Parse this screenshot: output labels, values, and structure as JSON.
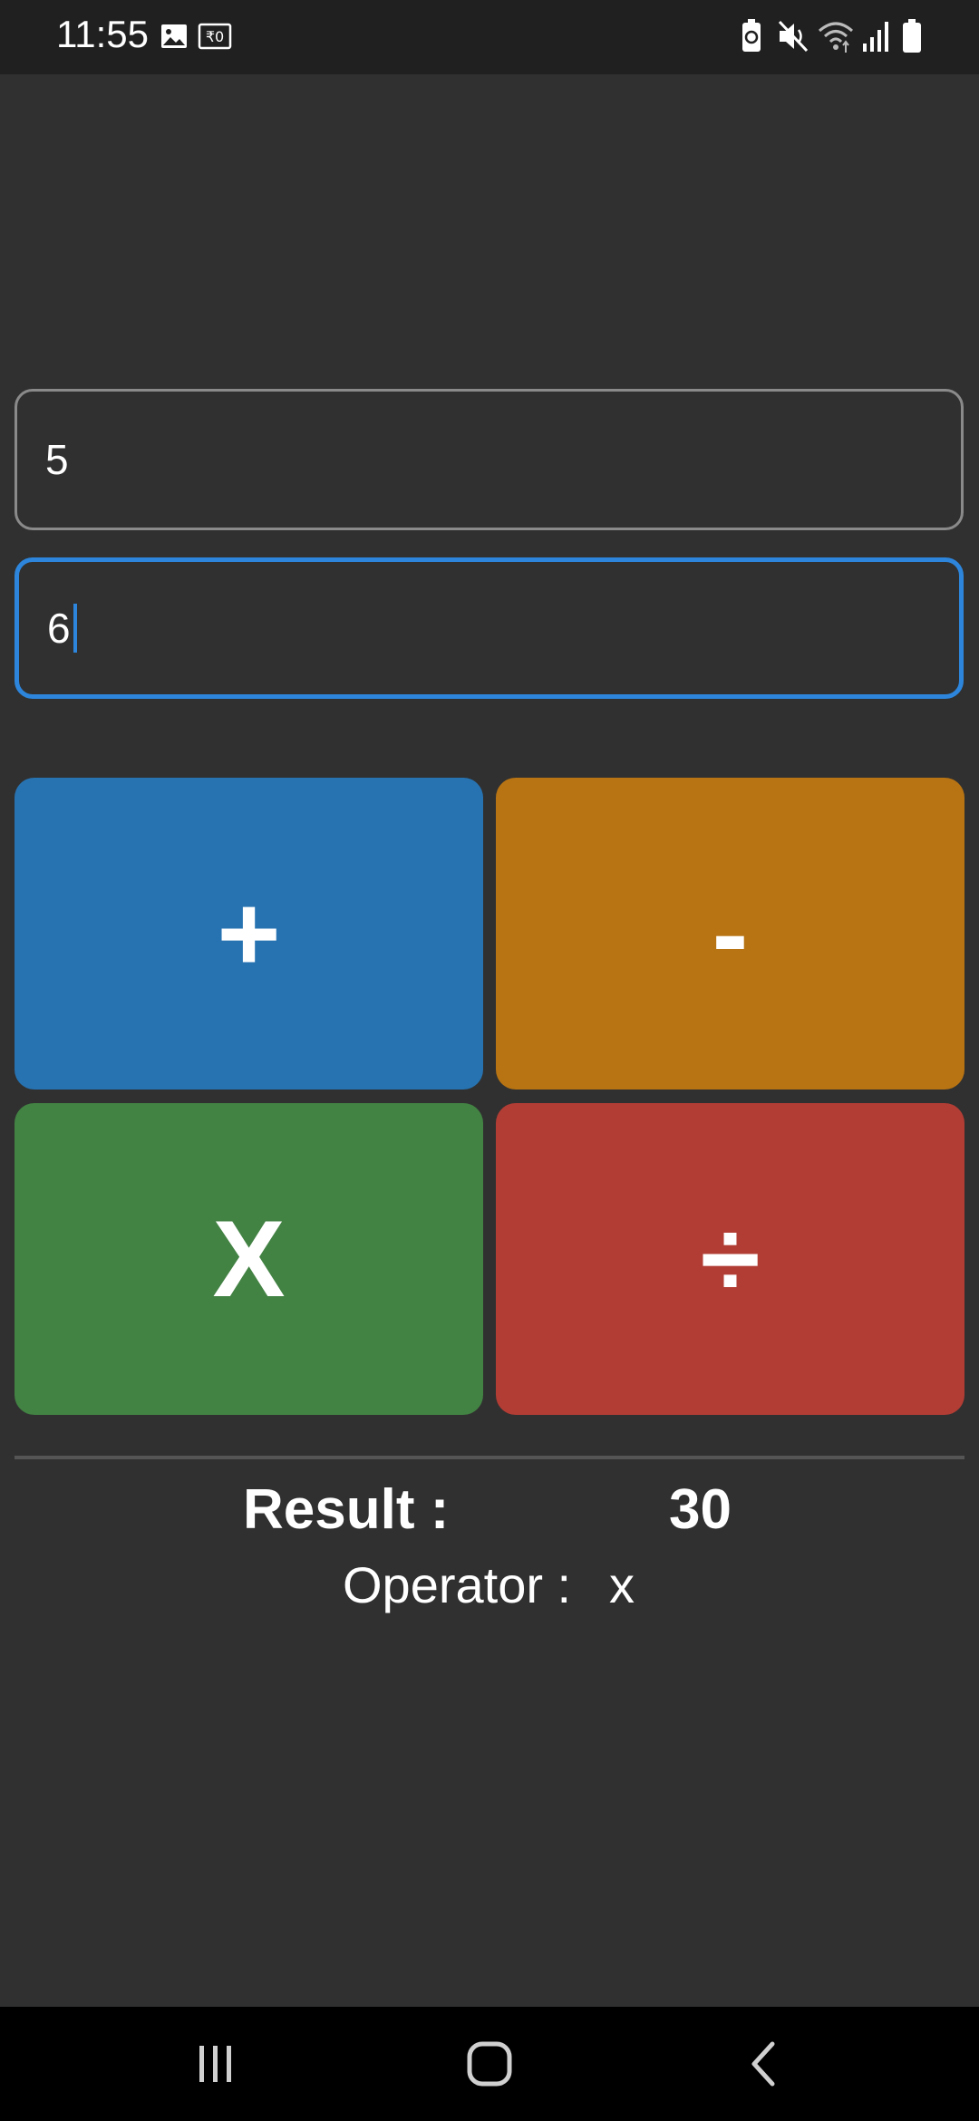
{
  "status_bar": {
    "time": "11:55",
    "left_icons": [
      "image-icon",
      "rupee-icon"
    ],
    "right_icons": [
      "battery-saver-icon",
      "mute-icon",
      "wifi-icon",
      "signal-icon",
      "battery-icon"
    ]
  },
  "inputs": {
    "first_value": "5",
    "second_value": "6"
  },
  "buttons": {
    "add": "+",
    "subtract": "-",
    "multiply": "X",
    "divide": "÷"
  },
  "result": {
    "label": "Result :",
    "value": "30"
  },
  "operator": {
    "label": "Operator :",
    "value": "x"
  },
  "colors": {
    "background": "#303030",
    "add": "#2773b2",
    "subtract": "#b87413",
    "multiply": "#428243",
    "divide": "#b23d35",
    "focus": "#2d86dc"
  },
  "nav_bar": {
    "icons": [
      "recent-apps-icon",
      "home-icon",
      "back-icon"
    ]
  }
}
